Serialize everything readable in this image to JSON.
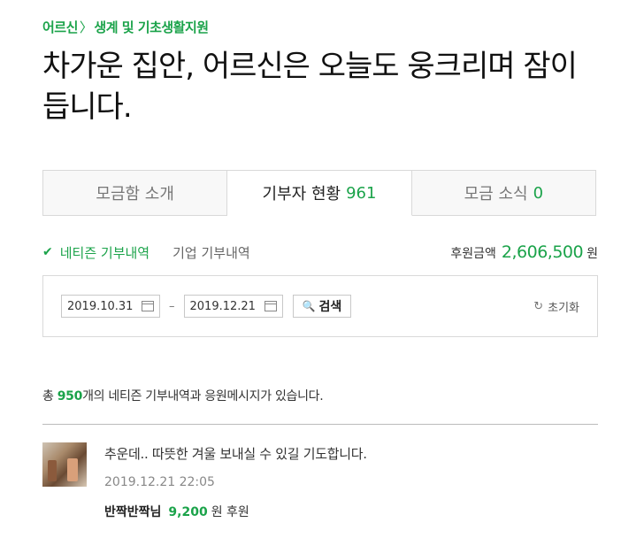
{
  "breadcrumb": {
    "parent": "어르신",
    "separator": "〉",
    "child": "생계 및 기초생활지원"
  },
  "title": "차가운 집안, 어르신은 오늘도 웅크리며 잠이 듭니다.",
  "tabs": [
    {
      "label": "모금함 소개",
      "count": ""
    },
    {
      "label": "기부자 현황",
      "count": "961"
    },
    {
      "label": "모금 소식",
      "count": "0"
    }
  ],
  "filters": {
    "active": "네티즌 기부내역",
    "other": "기업 기부내역"
  },
  "summary": {
    "label": "후원금액",
    "amount": "2,606,500",
    "unit": "원"
  },
  "search": {
    "start_date": "2019.10.31",
    "dash": "–",
    "end_date": "2019.12.21",
    "button": "검색",
    "reset": "초기화"
  },
  "total": {
    "prefix": "총 ",
    "count": "950",
    "suffix": "개의 네티즌 기부내역과 응원메시지가 있습니다."
  },
  "entries": [
    {
      "message": "추운데.. 따뜻한 겨울 보내실 수 있길 기도합니다.",
      "time": "2019.12.21 22:05",
      "donor": "반짝반짝님",
      "amount": "9,200",
      "unit": "원 후원"
    }
  ],
  "colors": {
    "accent": "#1ba34a",
    "border": "#d9d9d9"
  },
  "icons": {
    "check": "check-icon",
    "calendar": "calendar-icon",
    "search": "search-icon",
    "reset": "refresh-icon"
  }
}
